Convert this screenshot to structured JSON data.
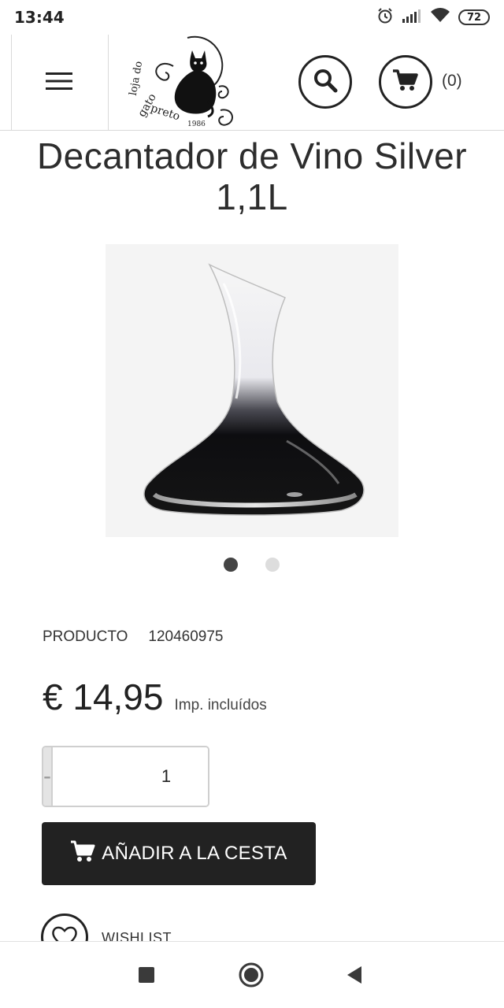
{
  "status_bar": {
    "time": "13:44",
    "battery": "72",
    "icons": [
      "alarm-icon",
      "signal-icon",
      "wifi-icon",
      "battery-icon"
    ]
  },
  "header": {
    "menu_icon": "hamburger-menu-icon",
    "logo_alt": "gato preto 1986",
    "search_icon": "search-icon",
    "cart_icon": "cart-icon",
    "cart_count": "(0)"
  },
  "product": {
    "title": "Decantador de Vino Silver 1,1L",
    "ref_label": "PRODUCTO",
    "ref_value": "120460975",
    "price": "€ 14,95",
    "tax_note": "Imp. incluídos",
    "quantity": "1",
    "minus_label": "-",
    "plus_label": "+",
    "add_to_cart": "AÑADIR A LA CESTA",
    "wishlist": "WISHLIST"
  },
  "gallery": {
    "active_index": 0,
    "total": 2
  },
  "colors": {
    "primary": "#222222",
    "dot_active": "#444444",
    "dot_inactive": "#dddddd",
    "qty_bg": "#e4e4e4"
  },
  "nav_bar": {
    "icons": [
      "square-recent-icon",
      "circle-home-icon",
      "triangle-back-icon"
    ]
  }
}
